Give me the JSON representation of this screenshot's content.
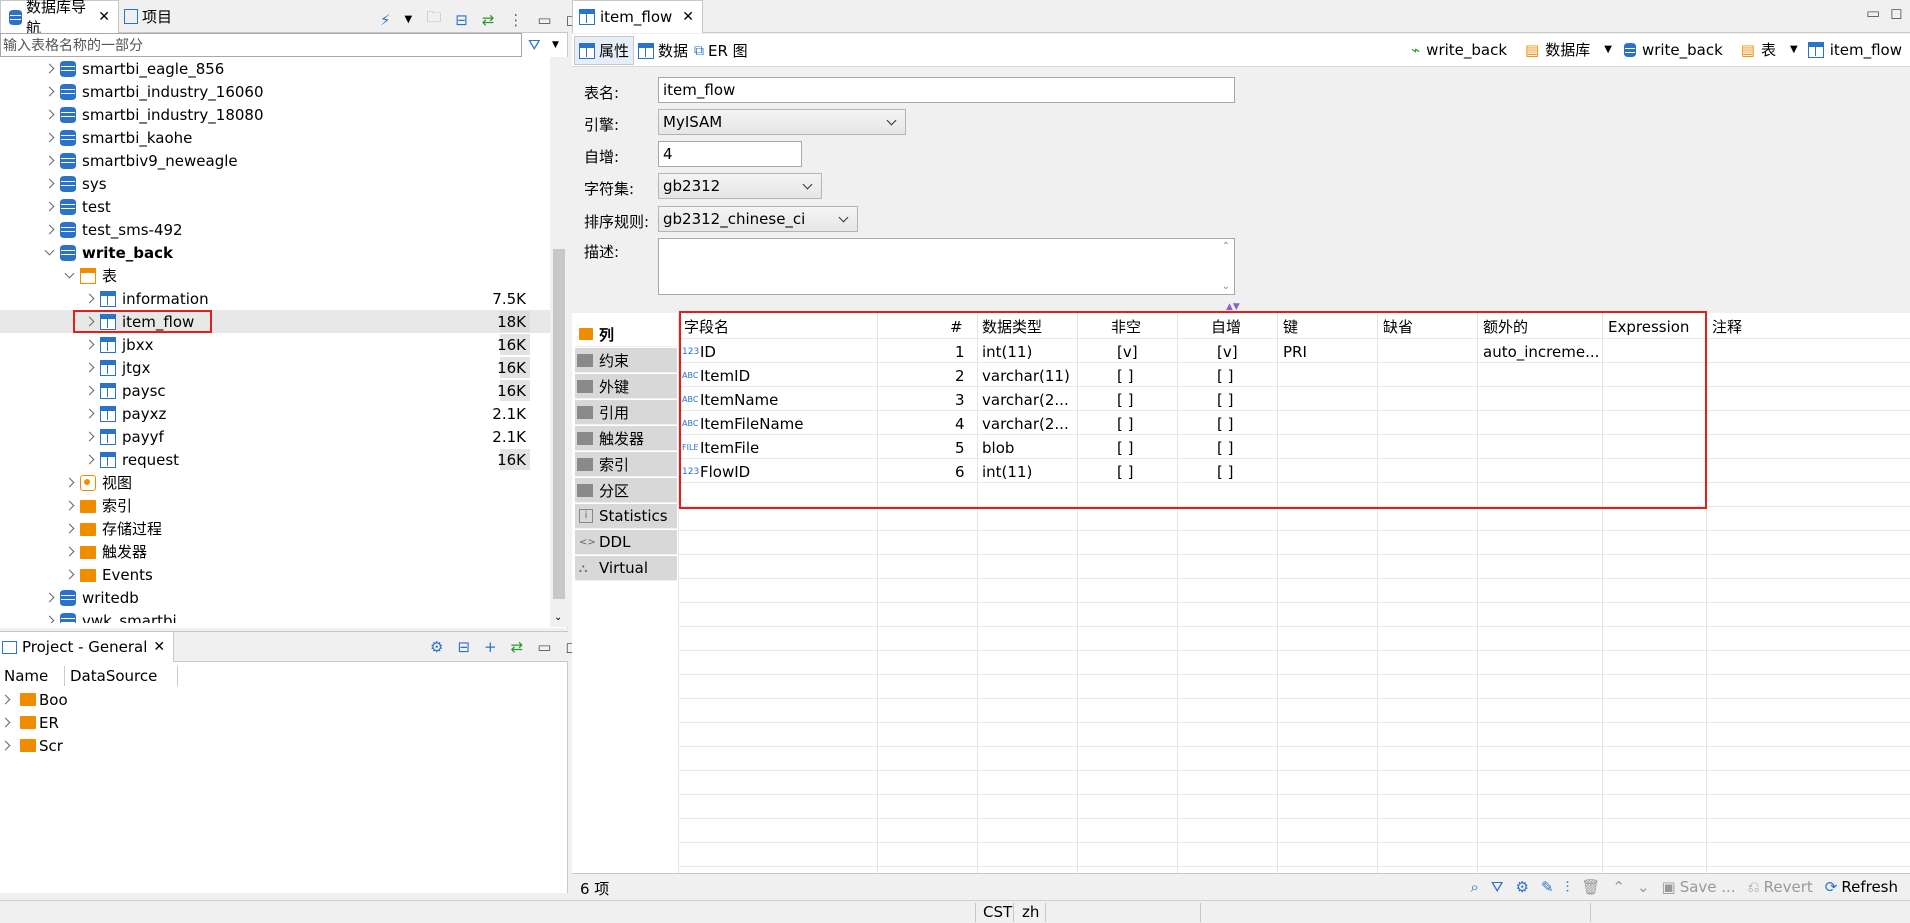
{
  "nav_panel": {
    "tab_db_navigator": "数据库导航",
    "tab_projects": "项目",
    "filter_placeholder": "输入表格名称的一部分",
    "tree": [
      {
        "label": "smartbi_eagle_856"
      },
      {
        "label": "smartbi_industry_16060"
      },
      {
        "label": "smartbi_industry_18080"
      },
      {
        "label": "smartbi_kaohe"
      },
      {
        "label": "smartbiv9_neweagle"
      },
      {
        "label": "sys"
      },
      {
        "label": "test"
      },
      {
        "label": "test_sms-492"
      },
      {
        "label": "write_back"
      },
      {
        "label": "表"
      },
      {
        "label": "information",
        "size": "7.5K"
      },
      {
        "label": "item_flow",
        "size": "18K"
      },
      {
        "label": "jbxx",
        "size": "16K"
      },
      {
        "label": "jtgx",
        "size": "16K"
      },
      {
        "label": "paysc",
        "size": "16K"
      },
      {
        "label": "payxz",
        "size": "2.1K"
      },
      {
        "label": "payyf",
        "size": "2.1K"
      },
      {
        "label": "request",
        "size": "16K"
      },
      {
        "label": "视图"
      },
      {
        "label": "索引"
      },
      {
        "label": "存储过程"
      },
      {
        "label": "触发器"
      },
      {
        "label": "Events"
      },
      {
        "label": "writedb"
      },
      {
        "label": "vwk_smartbi"
      }
    ]
  },
  "project_panel": {
    "title": "Project - General",
    "col_name": "Name",
    "col_datasource": "DataSource",
    "items": [
      "Boo",
      "ER",
      "Scr"
    ]
  },
  "editor": {
    "tab_title": "item_flow",
    "subtabs": [
      "属性",
      "数据",
      "ER 图"
    ],
    "breadcrumb": [
      "write_back",
      "数据库",
      "write_back",
      "表",
      "item_flow"
    ],
    "form": {
      "table_name_label": "表名:",
      "table_name_value": "item_flow",
      "engine_label": "引擎:",
      "engine_value": "MyISAM",
      "auto_inc_label": "自增:",
      "auto_inc_value": "4",
      "charset_label": "字符集:",
      "charset_value": "gb2312",
      "collation_label": "排序规则:",
      "collation_value": "gb2312_chinese_ci",
      "desc_label": "描述:"
    },
    "side_tabs": [
      "列",
      "约束",
      "外键",
      "引用",
      "触发器",
      "索引",
      "分区",
      "Statistics",
      "DDL",
      "Virtual"
    ],
    "columns_header": [
      "字段名",
      "#",
      "数据类型",
      "非空",
      "自增",
      "键",
      "缺省",
      "额外的",
      "Expression",
      "注释"
    ],
    "rows": [
      {
        "icon": "123",
        "name": "ID",
        "num": "1",
        "type": "int(11)",
        "notnull": "[v]",
        "autoinc": "[v]",
        "key": "PRI",
        "extra": "auto_increme..."
      },
      {
        "icon": "ABC",
        "name": "ItemID",
        "num": "2",
        "type": "varchar(11)",
        "notnull": "[ ]",
        "autoinc": "[ ]",
        "key": "",
        "extra": ""
      },
      {
        "icon": "ABC",
        "name": "ItemName",
        "num": "3",
        "type": "varchar(2...",
        "notnull": "[ ]",
        "autoinc": "[ ]",
        "key": "",
        "extra": ""
      },
      {
        "icon": "ABC",
        "name": "ItemFileName",
        "num": "4",
        "type": "varchar(2...",
        "notnull": "[ ]",
        "autoinc": "[ ]",
        "key": "",
        "extra": ""
      },
      {
        "icon": "FILE",
        "name": "ItemFile",
        "num": "5",
        "type": "blob",
        "notnull": "[ ]",
        "autoinc": "[ ]",
        "key": "",
        "extra": ""
      },
      {
        "icon": "123",
        "name": "FlowID",
        "num": "6",
        "type": "int(11)",
        "notnull": "[ ]",
        "autoinc": "[ ]",
        "key": "",
        "extra": ""
      }
    ],
    "status_count": "6 项",
    "toolbar": {
      "save": "Save ...",
      "revert": "Revert",
      "refresh": "Refresh"
    }
  },
  "statusbar": {
    "timezone": "CST",
    "locale": "zh"
  },
  "colors": {
    "accent": "#2a73c9",
    "highlight": "#e0201b",
    "folder": "#f08c00"
  }
}
